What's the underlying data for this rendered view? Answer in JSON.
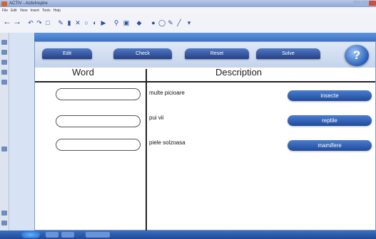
{
  "window": {
    "title": "ACTIV - ActivInspire"
  },
  "menu": {
    "items": [
      "File",
      "Edit",
      "View",
      "Insert",
      "Tools",
      "Help"
    ]
  },
  "toolbar": {
    "back_icon": "arrow-left",
    "forward_icon": "arrow-right"
  },
  "activity": {
    "buttons": {
      "edit": "Edit",
      "check": "Check",
      "reset": "Reset",
      "solve": "Solve",
      "help": "?"
    },
    "headers": {
      "word": "Word",
      "description": "Description"
    },
    "rows": [
      {
        "description": "multe picioare",
        "answer": "insecte"
      },
      {
        "description": "pui vii",
        "answer": "reptile"
      },
      {
        "description": "piele solzoasa",
        "answer": "mamifere"
      }
    ]
  },
  "colors": {
    "tab_blue": "#263f85",
    "answer_blue": "#1f4a9a",
    "strip_blue": "#3c72c6"
  }
}
